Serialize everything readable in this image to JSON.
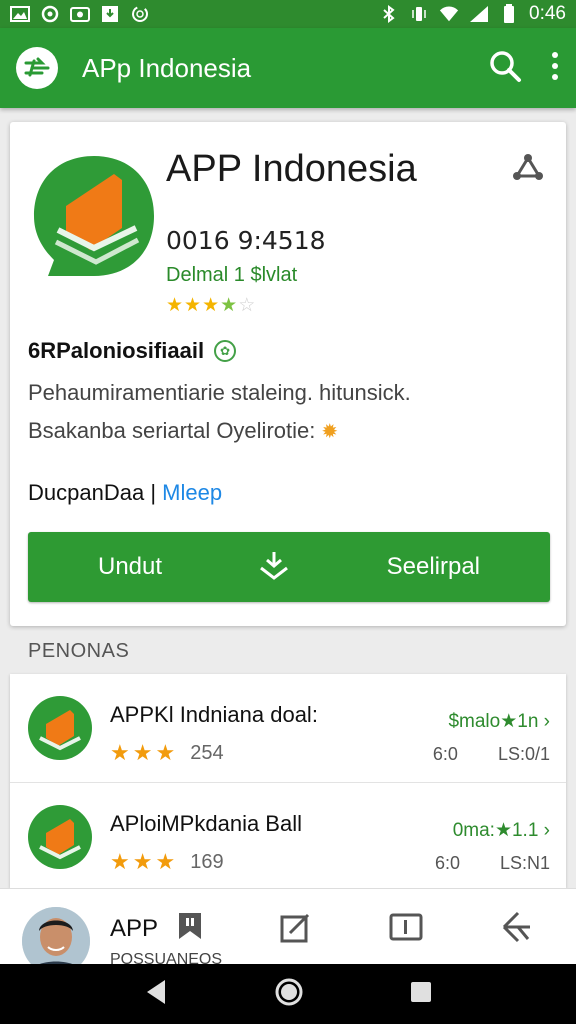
{
  "status_bar": {
    "time": "0:46",
    "icons": [
      "image-icon",
      "circle-icon",
      "camera-icon",
      "download-icon",
      "sync-icon",
      "bluetooth-icon",
      "vibrate-icon",
      "wifi-icon",
      "signal-icon",
      "battery-icon"
    ]
  },
  "appbar": {
    "title": "APp Indonesia",
    "icons": [
      "menu-logo-icon",
      "search-icon",
      "more-vert-icon"
    ]
  },
  "detail": {
    "name": "APP Indonesia",
    "meta": "0016 9:4518",
    "developer": "Delmal 1 $lvlat",
    "rating_stars": 3.5,
    "section_title": "6RPaloniosifiaail",
    "desc_line1": "Pehaumiramentiarie staleing. hitunsick.",
    "desc_line2": "Bsakanba seriartal Oyelirotie:",
    "dev_label": "DucpanDaa",
    "dev_separator": "|",
    "dev_link": "Mleep",
    "btn_left": "Undut",
    "btn_right": "Seelirpal"
  },
  "list": {
    "heading": "PENONAS",
    "items": [
      {
        "name": "APPKl Indniana doal:",
        "stars": 3,
        "count": "254",
        "price": "$malo★1n",
        "sub_left": "6:0",
        "sub_right": "LS:0/1"
      },
      {
        "name": "APloiMPkdania Ball",
        "stars": 3,
        "count": "169",
        "price": "0ma:★1.1",
        "sub_left": "6:0",
        "sub_right": "LS:N1"
      }
    ]
  },
  "bottom_nav": {
    "app": "APP",
    "sub": "POSSUANEOS"
  },
  "colors": {
    "primary": "#2a9a34",
    "status": "#2e8b2e",
    "accent_orange": "#f07a16",
    "star": "#f4b400",
    "link": "#1e88e5"
  }
}
